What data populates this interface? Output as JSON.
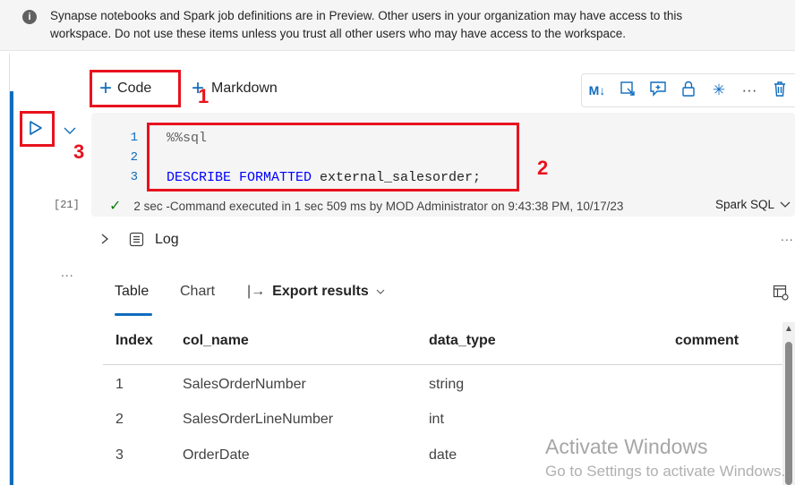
{
  "banner": {
    "icon": "info-icon",
    "line1": "Synapse notebooks and Spark job definitions are in Preview. Other users in your organization may have access to this",
    "line2": "workspace. Do not use these items unless you trust all other users who may have access to the workspace."
  },
  "toolbar": {
    "add_code_label": "Code",
    "add_markdown_label": "Markdown",
    "annotation_1": "1",
    "tools": [
      "markdown-toggle-icon",
      "collapse-icon",
      "comment-icon",
      "lock-icon",
      "freeze-icon",
      "more-icon",
      "delete-icon"
    ]
  },
  "cell": {
    "annotation_2": "2",
    "annotation_3": "3",
    "execution_count": "[21]",
    "lines": [
      {
        "num": "1",
        "magic": "%%sql",
        "kw": "",
        "rest": ""
      },
      {
        "num": "2",
        "magic": "",
        "kw": "",
        "rest": ""
      },
      {
        "num": "3",
        "magic": "",
        "kw": "DESCRIBE FORMATTED",
        "rest": " external_salesorder;"
      }
    ],
    "status": "2 sec -Command executed in 1 sec 509 ms by MOD Administrator on 9:43:38 PM, 10/17/23",
    "language": "Spark SQL",
    "log_label": "Log",
    "ellipsis": "..."
  },
  "results": {
    "tabs": [
      "Table",
      "Chart"
    ],
    "export_label": "Export results",
    "columns": [
      "Index",
      "col_name",
      "data_type",
      "comment"
    ],
    "rows": [
      [
        "1",
        "SalesOrderNumber",
        "string",
        ""
      ],
      [
        "2",
        "SalesOrderLineNumber",
        "int",
        ""
      ],
      [
        "3",
        "OrderDate",
        "date",
        ""
      ]
    ]
  },
  "watermark": {
    "line1": "Activate Windows",
    "line2": "Go to Settings to activate Windows."
  },
  "colors": {
    "accent": "#0f6cbd",
    "annotation_red": "#e8121d",
    "success": "#107c10"
  }
}
